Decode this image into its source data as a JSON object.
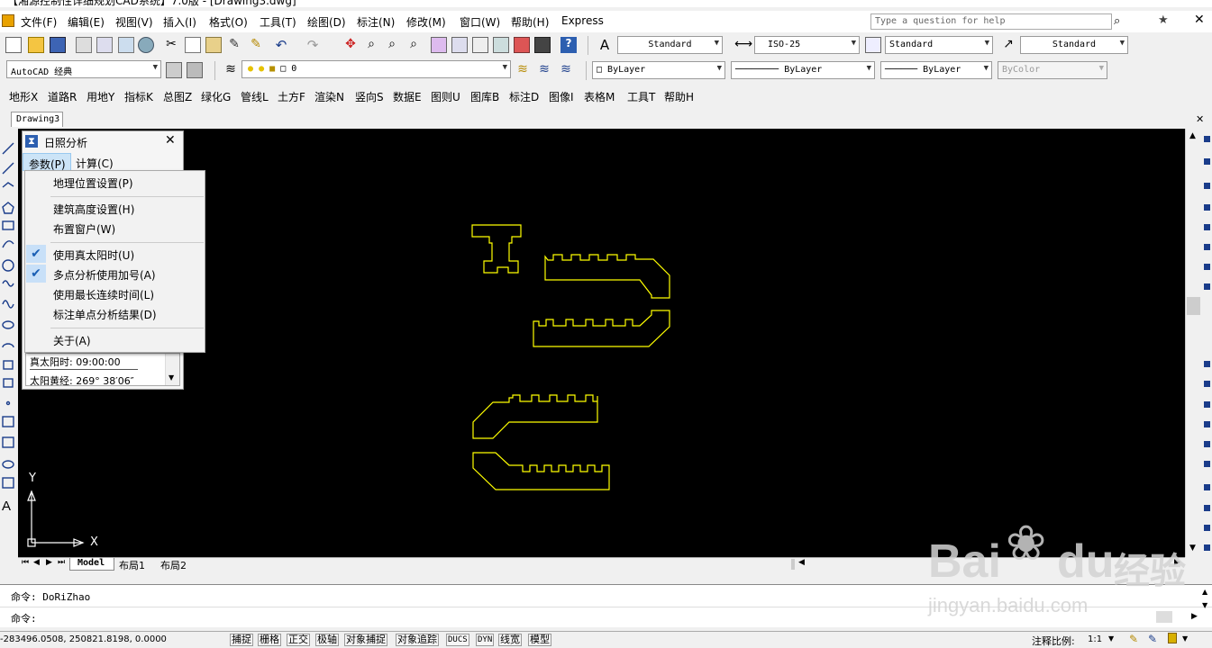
{
  "title_bar": {
    "text": "【湘源控制性详细规划CAD系统】7.0版 - [Drawing3.dwg]"
  },
  "menubar": {
    "items": [
      "文件(F)",
      "编辑(E)",
      "视图(V)",
      "插入(I)",
      "格式(O)",
      "工具(T)",
      "绘图(D)",
      "标注(N)",
      "修改(M)",
      "窗口(W)",
      "帮助(H)",
      "Express"
    ],
    "help_placeholder": "Type a question for help"
  },
  "toolbar1": {
    "text_style": "Standard",
    "dim_style": "ISO-25",
    "table_style": "Standard",
    "multileader_style": "Standard"
  },
  "toolbar2": {
    "workspace": "AutoCAD 经典",
    "layer": "0",
    "color": "ByLayer",
    "linetype": "ByLayer",
    "lineweight": "ByLayer",
    "plotstyle": "ByColor"
  },
  "toolbar3": {
    "items": [
      "地形X",
      "道路R",
      "用地Y",
      "指标K",
      "总图Z",
      "绿化G",
      "管线L",
      "土方F",
      "渲染N",
      "竖向S",
      "数据E",
      "图则U",
      "图库B",
      "标注D",
      "图像I",
      "表格M",
      "工具T",
      "帮助H"
    ]
  },
  "document_tab": "Drawing3",
  "sun_window": {
    "title": "日照分析",
    "menu_params": "参数(P)",
    "menu_calc": "计算(C)",
    "solar_time": "真太阳时: 09:00:00",
    "solar_lon": "太阳黄经: 269° 38′06″"
  },
  "params_menu": {
    "items": [
      {
        "label": "地理位置设置(P)",
        "checked": false
      },
      {
        "label": "建筑高度设置(H)",
        "checked": false
      },
      {
        "label": "布置窗户(W)",
        "checked": false
      },
      {
        "label": "使用真太阳时(U)",
        "checked": true
      },
      {
        "label": "多点分析使用加号(A)",
        "checked": true
      },
      {
        "label": "使用最长连续时间(L)",
        "checked": false
      },
      {
        "label": "标注单点分析结果(D)",
        "checked": false
      },
      {
        "label": "关于(A)",
        "checked": false
      }
    ]
  },
  "ucs": {
    "x": "X",
    "y": "Y"
  },
  "layout_tabs": [
    "Model",
    "布局1",
    "布局2"
  ],
  "command": {
    "history": "命令: DoRiZhao",
    "prompt": "命令:"
  },
  "status": {
    "coords": "-283496.0508, 250821.8198, 0.0000",
    "buttons": [
      "捕捉",
      "栅格",
      "正交",
      "极轴",
      "对象捕捉",
      "对象追踪",
      "DUCS",
      "DYN",
      "线宽",
      "模型"
    ],
    "annotation_scale_label": "注释比例:",
    "annotation_scale": "1:1"
  },
  "watermark": {
    "text1": "Bai",
    "text2": "du",
    "text3": "经验",
    "url": "jingyan.baidu.com"
  },
  "colors": {
    "canvas": "#000000",
    "drawing": "#ffff00",
    "accent": "#1a5fb4"
  }
}
